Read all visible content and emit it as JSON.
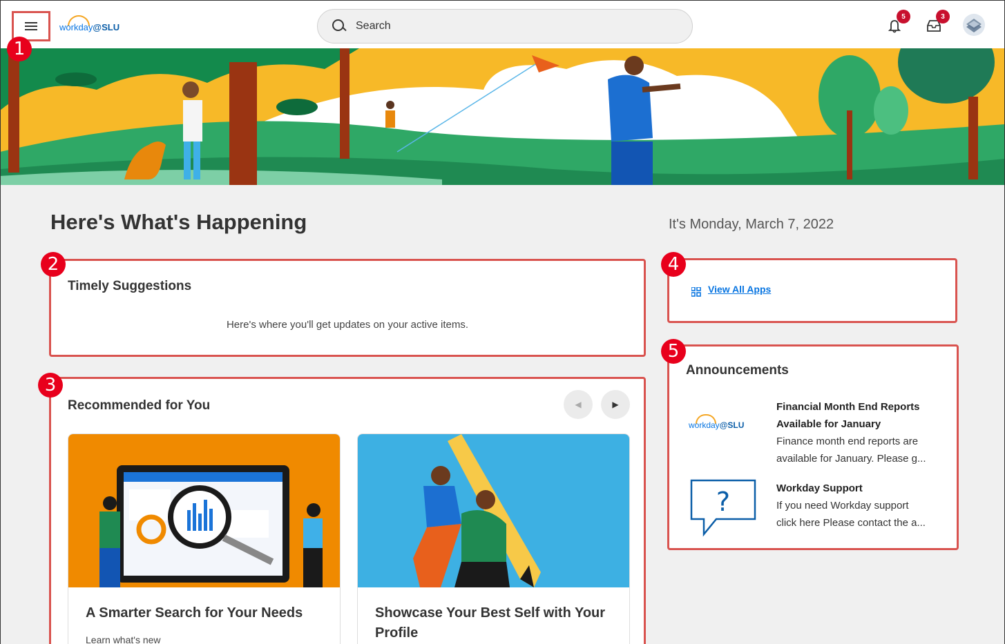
{
  "topbar": {
    "logo_text": "workday",
    "logo_suffix": "@SLU",
    "search_placeholder": "Search",
    "notifications_count": "5",
    "inbox_count": "3"
  },
  "callouts": [
    "1",
    "2",
    "3",
    "4",
    "5"
  ],
  "page": {
    "title": "Here's What's Happening",
    "date": "It's Monday, March 7, 2022"
  },
  "timely": {
    "title": "Timely Suggestions",
    "message": "Here's where you'll get updates on your active items."
  },
  "recommended": {
    "title": "Recommended for You",
    "cards": [
      {
        "title": "A Smarter Search for Your Needs",
        "subtitle": "Learn what's new"
      },
      {
        "title": "Showcase Your Best Self with Your Profile"
      }
    ]
  },
  "apps": {
    "link": "View All Apps"
  },
  "announcements": {
    "title": "Announcements",
    "items": [
      {
        "logo_text": "workday",
        "logo_suffix": "@SLU",
        "heading_1": "Financial Month End Reports",
        "heading_2": "Available for January",
        "body_1": "Finance month end reports are",
        "body_2": "available for January. Please g..."
      },
      {
        "heading_1": "Workday Support",
        "body_1": "If you need Workday support",
        "body_2": "click here Please contact the a..."
      }
    ]
  },
  "colors": {
    "accent": "#0875e1",
    "highlight": "#d9534f",
    "callout": "#e8001c"
  }
}
